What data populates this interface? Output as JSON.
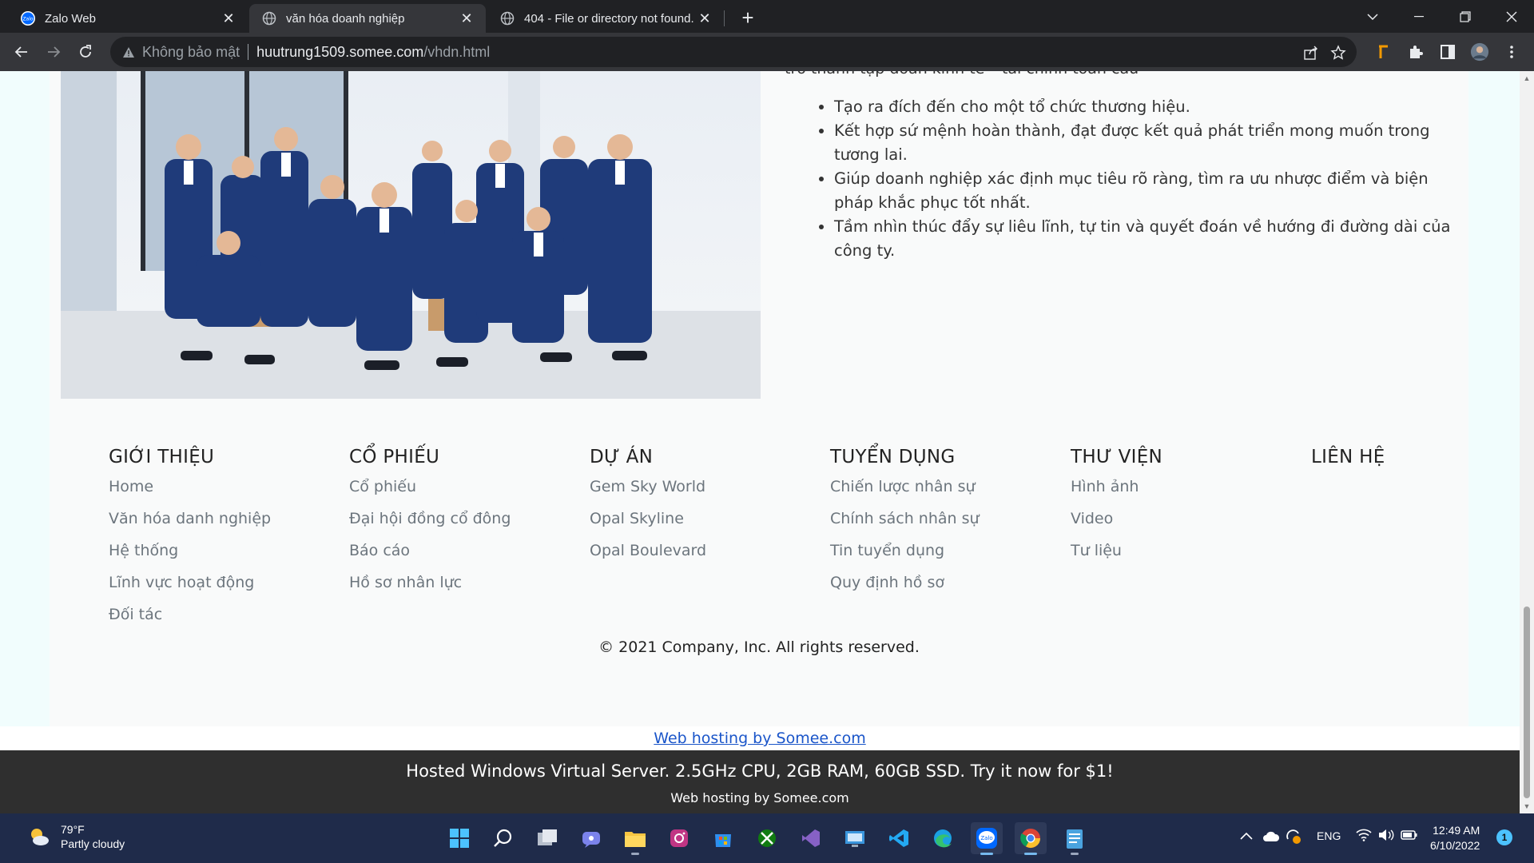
{
  "browser": {
    "tabs": [
      {
        "title": "Zalo Web",
        "active": false,
        "favicon": "zalo-icon"
      },
      {
        "title": "văn hóa doanh nghiệp",
        "active": true,
        "favicon": "globe-icon"
      },
      {
        "title": "404 - File or directory not found.",
        "active": false,
        "favicon": "globe-icon"
      }
    ],
    "omnibox": {
      "security_label": "Không bảo mật",
      "host": "huutrung1509.somee.com",
      "path": "/vhdn.html"
    }
  },
  "page": {
    "cut_text": "trở thành tập đoàn kinh tế – tài chính toàn cầu",
    "bullets": [
      "Tạo ra đích đến cho một tổ chức thương hiệu.",
      "Kết hợp sứ mệnh hoàn thành, đạt được kết quả phát triển mong muốn trong tương lai.",
      "Giúp doanh nghiệp xác định mục tiêu rõ ràng, tìm ra ưu nhược điểm và biện pháp khắc phục tốt nhất.",
      "Tầm nhìn thúc đẩy sự liêu lĩnh, tự tin và quyết đoán về hướng đi đường dài của công ty."
    ],
    "footer": {
      "columns": [
        {
          "heading": "GIỚI THIỆU",
          "links": [
            "Home",
            "Văn hóa danh nghiệp",
            "Hệ thống",
            "Lĩnh vực hoạt động",
            "Đối tác"
          ]
        },
        {
          "heading": "CỔ PHIẾU",
          "links": [
            "Cổ phiếu",
            "Đại hội đồng cổ đông",
            "Báo cáo",
            "Hồ sơ nhân lực"
          ]
        },
        {
          "heading": "DỰ ÁN",
          "links": [
            "Gem Sky World",
            "Opal Skyline",
            "Opal Boulevard"
          ]
        },
        {
          "heading": "TUYỂN DỤNG",
          "links": [
            "Chiến lược nhân sự",
            "Chính sách nhân sự",
            "Tin tuyển dụng",
            "Quy định hồ sơ"
          ]
        },
        {
          "heading": "THƯ VIỆN",
          "links": [
            "Hình ảnh",
            "Video",
            "Tư liệu"
          ]
        },
        {
          "heading": "LIÊN HỆ",
          "links": []
        }
      ],
      "copyright": "© 2021 Company, Inc. All rights reserved."
    },
    "somee": {
      "link": "Web hosting by Somee.com",
      "banner": "Hosted Windows Virtual Server. 2.5GHz CPU, 2GB RAM, 60GB SSD. Try it now for $1!",
      "small": "Web hosting by Somee.com"
    }
  },
  "taskbar": {
    "weather_temp": "79°F",
    "weather_desc": "Partly cloudy",
    "lang": "ENG",
    "time": "12:49 AM",
    "date": "6/10/2022",
    "notification_count": "1",
    "apps": [
      "windows-start-icon",
      "search-icon",
      "task-view-icon",
      "teams-chat-icon",
      "file-explorer-icon",
      "instagram-icon",
      "microsoft-store-icon",
      "xbox-icon",
      "visual-studio-icon",
      "remote-desktop-icon",
      "vscode-icon",
      "edge-icon",
      "zalo-icon",
      "chrome-icon",
      "notepad-icon"
    ]
  },
  "colors": {
    "chrome_dark": "#202124",
    "chrome_tab": "#35363a",
    "footer_link": "#6c757d",
    "somee_link": "#1a55c9",
    "taskbar": "#1f2b4a"
  }
}
